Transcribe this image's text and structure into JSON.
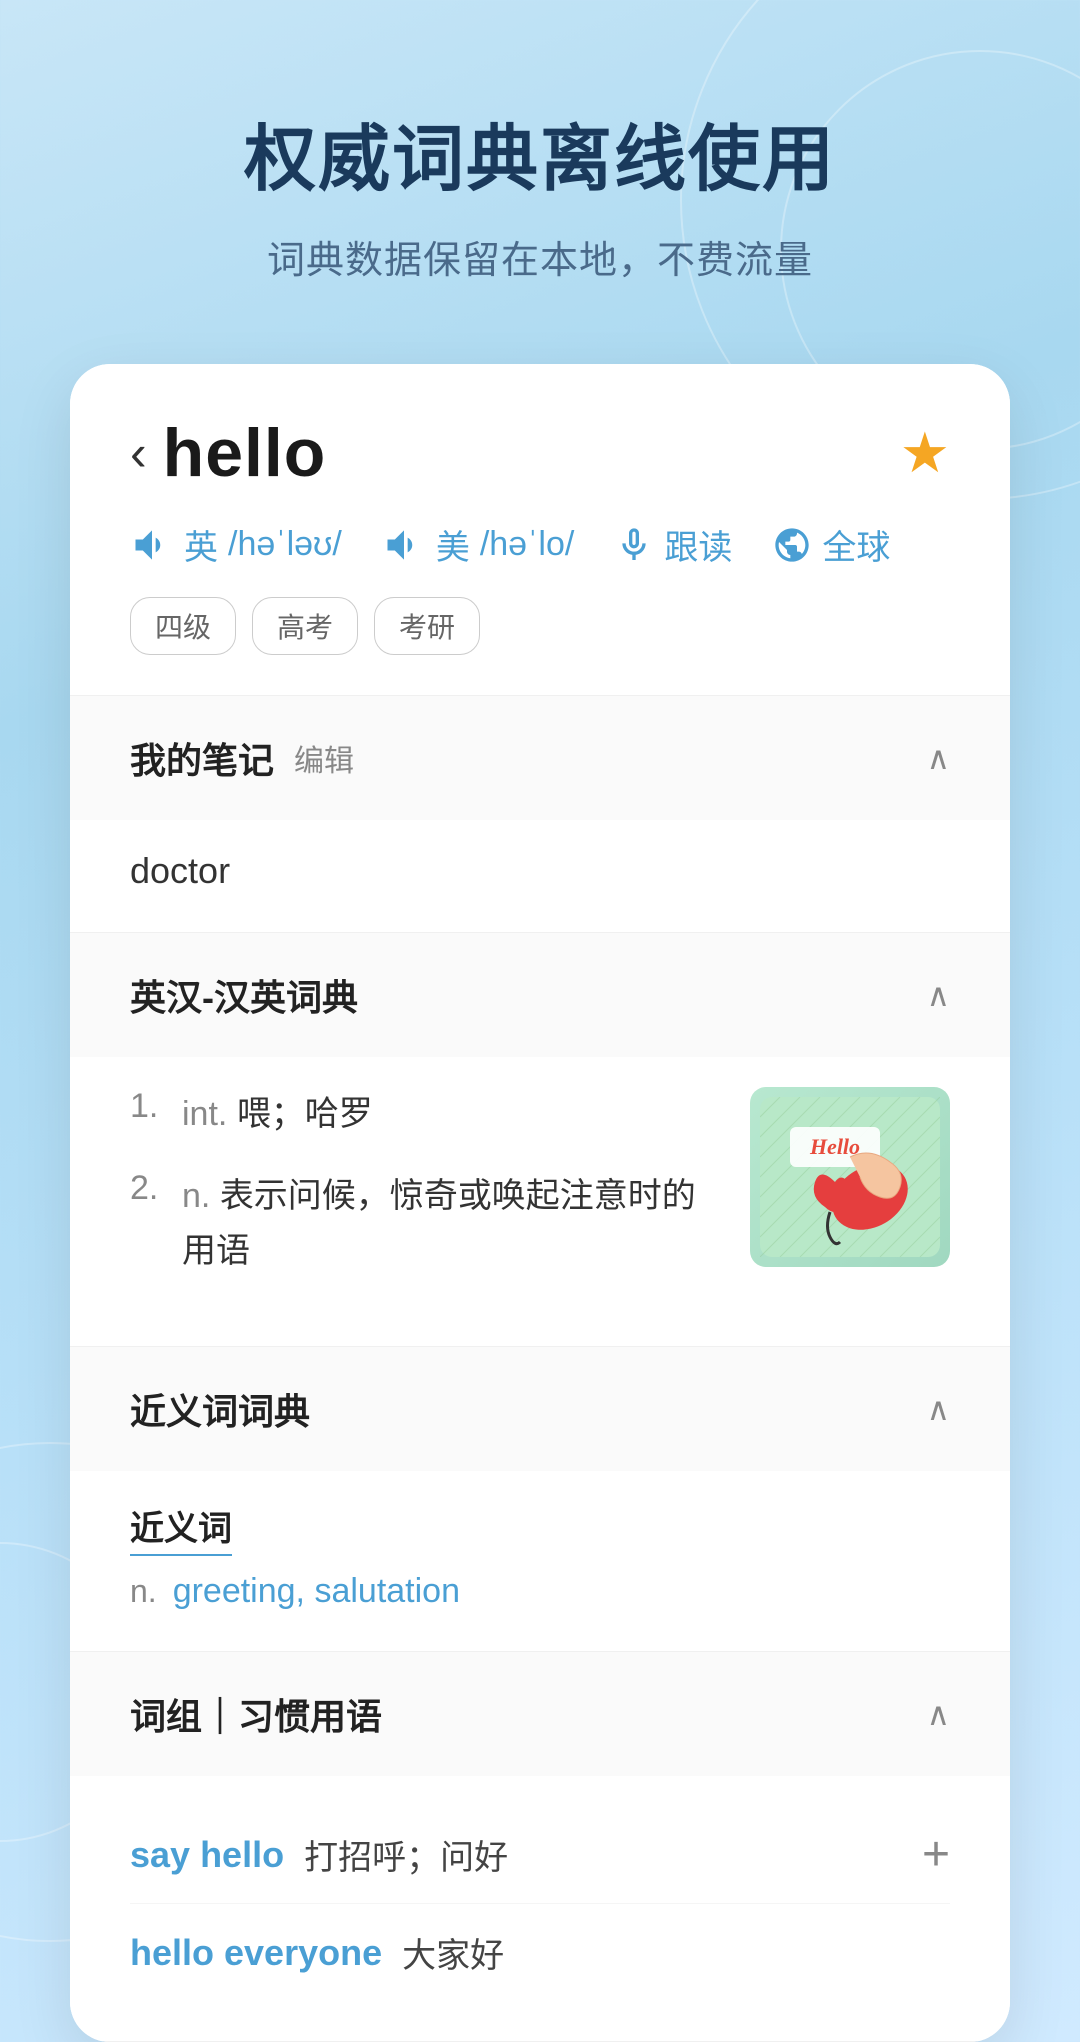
{
  "hero": {
    "title": "权威词典离线使用",
    "subtitle": "词典数据保留在本地，不费流量"
  },
  "card": {
    "back_arrow": "‹",
    "word": "hello",
    "star": "★",
    "phonetics": {
      "uk_label": "英",
      "uk_phonetic": "/həˈləʊ/",
      "us_label": "美",
      "us_phonetic": "/həˈlo/",
      "follow_read": "跟读",
      "global": "全球"
    },
    "tags": [
      "四级",
      "高考",
      "考研"
    ],
    "sections": {
      "notes": {
        "title": "我的笔记",
        "edit_label": "编辑",
        "content": "doctor"
      },
      "dictionary": {
        "title": "英汉-汉英词典",
        "definitions": [
          {
            "num": "1.",
            "pos": "int.",
            "text": "喂；哈罗"
          },
          {
            "num": "2.",
            "pos": "n.",
            "text": "表示问候，惊奇或唤起注意时的用语"
          }
        ]
      },
      "synonyms": {
        "title": "近义词词典",
        "synonym_label": "近义词",
        "pos": "n.",
        "words": "greeting, salutation"
      },
      "phrases": {
        "title": "词组｜习惯用语",
        "items": [
          {
            "en": "say hello",
            "cn": "打招呼；问好",
            "has_add": true
          },
          {
            "en": "hello everyone",
            "cn": "大家好",
            "has_add": false
          }
        ]
      }
    }
  }
}
